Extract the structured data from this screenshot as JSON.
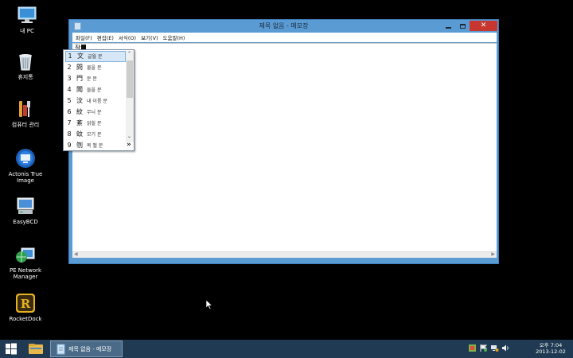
{
  "desktop": {
    "icons": [
      {
        "label": "내 PC"
      },
      {
        "label": "휴지통"
      },
      {
        "label": "컴퓨터 관리"
      },
      {
        "label": "Actonis True Image"
      },
      {
        "label": "EasyBCD"
      },
      {
        "label": "PE Network\nManager"
      },
      {
        "label": "RocketDock"
      }
    ]
  },
  "window": {
    "title": "제목 없음 - 메모장",
    "menu": [
      "파일(F)",
      "편집(E)",
      "서식(O)",
      "보기(V)",
      "도움말(H)"
    ],
    "editor_text": "잘"
  },
  "ime": {
    "candidates": [
      {
        "num": "1",
        "hanja": "文",
        "meaning": "글월 문"
      },
      {
        "num": "2",
        "hanja": "問",
        "meaning": "물을 문"
      },
      {
        "num": "3",
        "hanja": "門",
        "meaning": "문 문"
      },
      {
        "num": "4",
        "hanja": "聞",
        "meaning": "들을 문"
      },
      {
        "num": "5",
        "hanja": "汶",
        "meaning": "내 이름 문"
      },
      {
        "num": "6",
        "hanja": "紋",
        "meaning": "무늬 문"
      },
      {
        "num": "7",
        "hanja": "紊",
        "meaning": "얽힐 문"
      },
      {
        "num": "8",
        "hanja": "蚊",
        "meaning": "모기 문"
      },
      {
        "num": "9",
        "hanja": "刎",
        "meaning": "목 벨 문"
      }
    ],
    "more": "»",
    "selected_index": 0
  },
  "taskbar": {
    "notepad_label": "제목 없음 - 메모장",
    "clock_time": "오후 7:04",
    "clock_date": "2013-12-02"
  },
  "colors": {
    "window_frame": "#5a9bd4",
    "close_button": "#c7372f",
    "taskbar": "#1f3a52",
    "selected_candidate": "#d6e8f8"
  }
}
